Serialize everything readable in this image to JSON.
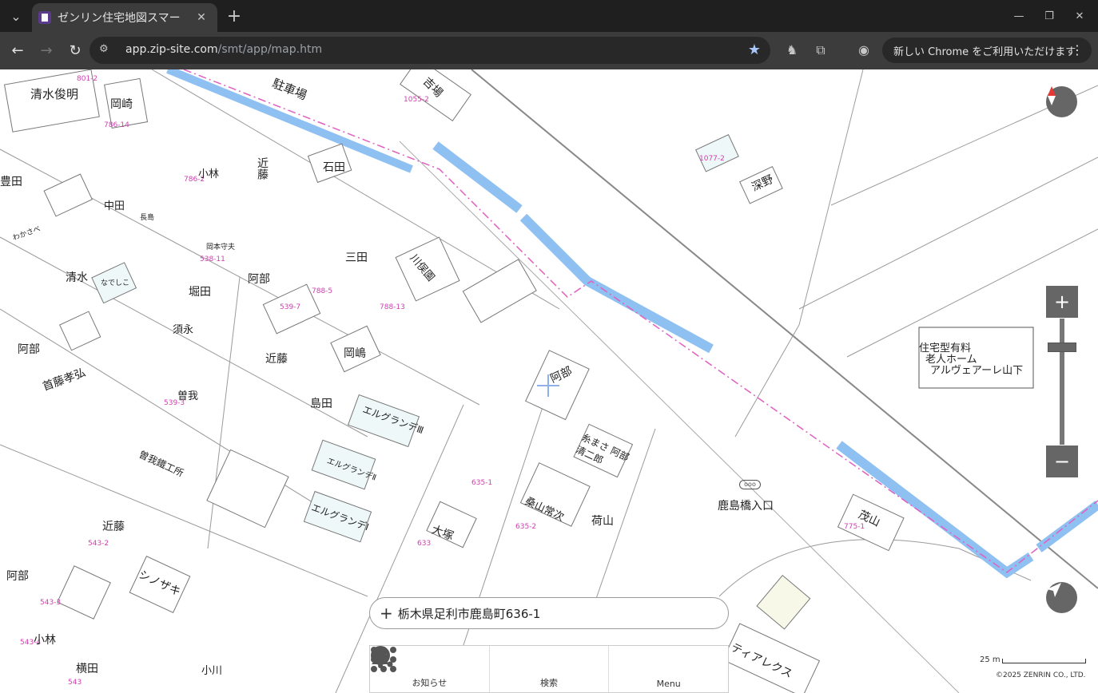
{
  "browser": {
    "tab_title": "ゼンリン住宅地図スマー",
    "url_host": "app.zip-site.com",
    "url_path": "/smt/app/map.htm",
    "update_message": "新しい Chrome をご利用いただけます"
  },
  "map": {
    "labels": [
      {
        "text": "清水俊明"
      },
      {
        "text": "岡崎"
      },
      {
        "text": "駐車場"
      },
      {
        "text": "吉場"
      },
      {
        "text": "豊田"
      },
      {
        "text": "小林"
      },
      {
        "text": "近藤"
      },
      {
        "text": "石田"
      },
      {
        "text": "中田"
      },
      {
        "text": "長島"
      },
      {
        "text": "わかさべ"
      },
      {
        "text": "三田"
      },
      {
        "text": "川俣園"
      },
      {
        "text": "岡本守夫"
      },
      {
        "text": "阿部"
      },
      {
        "text": "清水"
      },
      {
        "text": "なでしこ"
      },
      {
        "text": "堀田"
      },
      {
        "text": "須永"
      },
      {
        "text": "近藤"
      },
      {
        "text": "岡嶋"
      },
      {
        "text": "阿部"
      },
      {
        "text": "首藤孝弘"
      },
      {
        "text": "島田"
      },
      {
        "text": "曽我"
      },
      {
        "text": "エルグランデⅢ"
      },
      {
        "text": "阿部"
      },
      {
        "text": "曽我鐵工所"
      },
      {
        "text": "エルグランデⅡ"
      },
      {
        "text": "糸まさ 阿部清二郎"
      },
      {
        "text": "近藤"
      },
      {
        "text": "エルグランデⅠ"
      },
      {
        "text": "桑山常次"
      },
      {
        "text": "荷山"
      },
      {
        "text": "大塚"
      },
      {
        "text": "シノザキ"
      },
      {
        "text": "阿部"
      },
      {
        "text": "小林"
      },
      {
        "text": "横田"
      },
      {
        "text": "小川"
      },
      {
        "text": "深野"
      },
      {
        "text": "茂山"
      },
      {
        "text": "ティアレクス"
      },
      {
        "text": "鹿島橋入口"
      },
      {
        "text": "住宅型有料"
      },
      {
        "text": "老人ホーム"
      },
      {
        "text": "アルヴェアーレ山下"
      }
    ],
    "address": "栃木県足利市鹿島町636-1",
    "menu": {
      "notice": "お知らせ",
      "search": "検索",
      "menu": "Menu"
    },
    "scale_label": "25 m",
    "copyright": "©2025 ZENRIN CO., LTD."
  }
}
